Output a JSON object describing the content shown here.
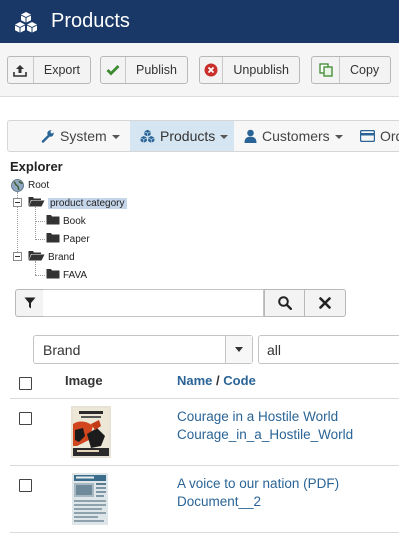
{
  "header": {
    "title": "Products",
    "logo_icon": "cubes-icon",
    "bg_color": "#1a3867"
  },
  "toolbar": {
    "buttons": [
      {
        "label": "Export",
        "icon": "upload-icon"
      },
      {
        "label": "Publish",
        "icon": "check-icon",
        "icon_color": "#3c8a2e"
      },
      {
        "label": "Unpublish",
        "icon": "circle-x-icon",
        "icon_color": "#c9302c"
      },
      {
        "label": "Copy",
        "icon": "copy-icon",
        "icon_color": "#3c8a2e"
      }
    ]
  },
  "nav": {
    "items": [
      {
        "label": "System",
        "icon": "wrench-icon",
        "active": false
      },
      {
        "label": "Products",
        "icon": "cubes-icon",
        "active": true
      },
      {
        "label": "Customers",
        "icon": "user-icon",
        "active": false
      },
      {
        "label": "Ord",
        "icon": "card-icon",
        "active": false
      }
    ]
  },
  "explorer": {
    "title": "Explorer",
    "root": "Root",
    "nodes": [
      {
        "label": "product category",
        "level": 1,
        "expanded": true,
        "selected": true
      },
      {
        "label": "Book",
        "level": 2
      },
      {
        "label": "Paper",
        "level": 2
      },
      {
        "label": "Brand",
        "level": 1,
        "expanded": true,
        "selected": false
      },
      {
        "label": "FAVA",
        "level": 2
      }
    ]
  },
  "search": {
    "value": "",
    "placeholder": ""
  },
  "filters": {
    "field": "Brand",
    "value": "all"
  },
  "table": {
    "columns": {
      "image": "Image",
      "name": "Name",
      "separator": "/",
      "code": "Code"
    },
    "rows": [
      {
        "name": "Courage in a Hostile World",
        "code": "Courage_in_a_Hostile_World"
      },
      {
        "name": "A voice to our nation (PDF)",
        "code": "Document__2"
      }
    ]
  },
  "colors": {
    "link": "#2a6496",
    "nav_active_bg": "#d5e5f1",
    "tree_selected_bg": "#c6d6ea"
  }
}
